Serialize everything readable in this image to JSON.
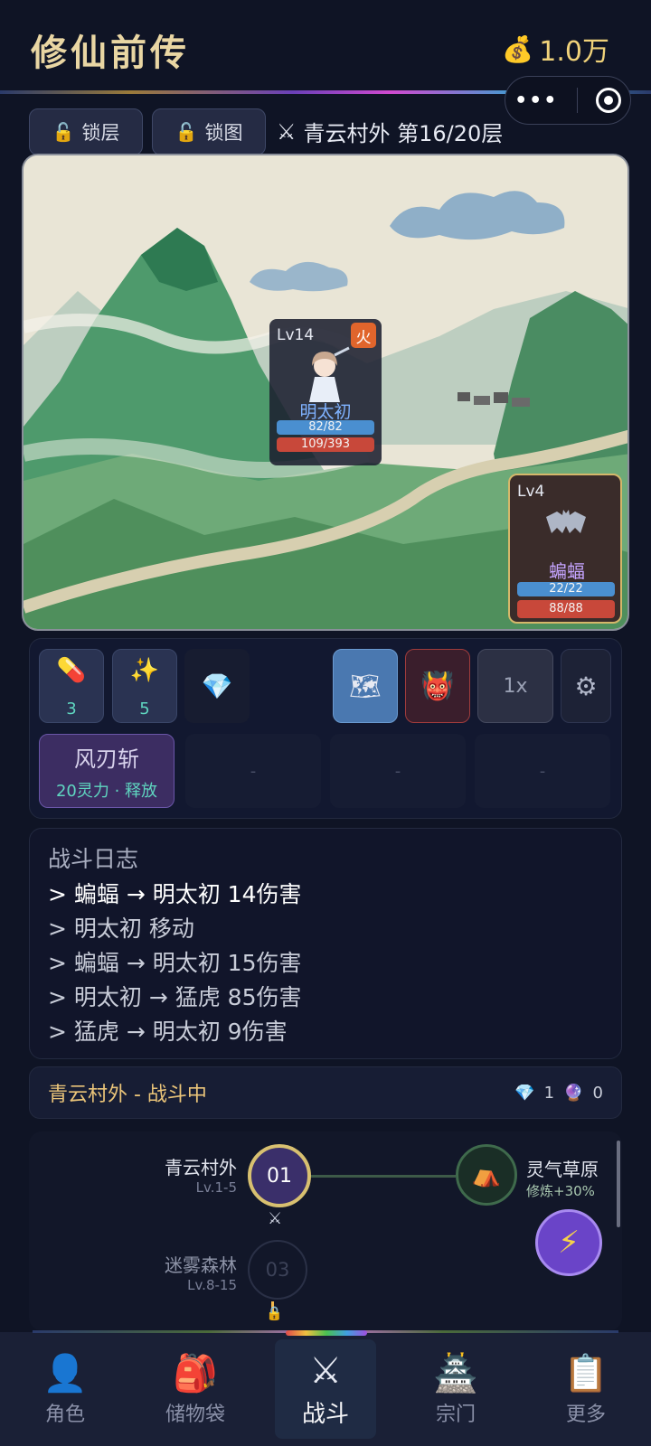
{
  "app": {
    "title": "修仙前传",
    "gold": "1.0万"
  },
  "toolbar": {
    "lock_floor": "锁层",
    "lock_map": "锁图",
    "stage": "青云村外 第16/20层"
  },
  "hero": {
    "level": "Lv14",
    "element": "火",
    "name": "明太初",
    "mana": "82/82",
    "hp": "109/393"
  },
  "enemy": {
    "level": "Lv4",
    "name": "蝙蝠",
    "mana": "22/22",
    "hp": "88/88"
  },
  "items": [
    {
      "icon": "pill-icon",
      "count": "3"
    },
    {
      "icon": "sparkle-icon",
      "count": "5"
    },
    {
      "icon": "diamond-icon",
      "count": ""
    }
  ],
  "controls": {
    "speed": "1x"
  },
  "skills": [
    {
      "name": "风刃斩",
      "cost": "20灵力 · 释放"
    },
    {
      "label": "-"
    },
    {
      "label": "-"
    },
    {
      "label": "-"
    }
  ],
  "log": {
    "title": "战斗日志",
    "lines": [
      "> 蝙蝠 → 明太初 14伤害",
      "> 明太初 移动",
      "> 蝙蝠 → 明太初 15伤害",
      "> 明太初 → 猛虎 85伤害",
      "> 猛虎 → 明太初 9伤害"
    ]
  },
  "status": {
    "text": "青云村外 - 战斗中",
    "diamonds": "1",
    "orbs": "0"
  },
  "map": {
    "nodes": [
      {
        "name": "青云村外",
        "levels": "Lv.1-5",
        "number": "01"
      },
      {
        "name": "迷雾森林",
        "levels": "Lv.8-15",
        "number": "03"
      }
    ],
    "branch": {
      "name": "灵气草原",
      "bonus": "修炼+30%"
    }
  },
  "nav": [
    {
      "label": "角色",
      "icon": "person-icon"
    },
    {
      "label": "储物袋",
      "icon": "backpack-icon"
    },
    {
      "label": "战斗",
      "icon": "crossed-swords-icon"
    },
    {
      "label": "宗门",
      "icon": "pagoda-icon"
    },
    {
      "label": "更多",
      "icon": "clipboard-icon"
    }
  ],
  "colors": {
    "accent_gold": "#e9d6a3",
    "mana": "#4a8fd0",
    "hp": "#c8483a",
    "skill": "#3c2d62"
  }
}
